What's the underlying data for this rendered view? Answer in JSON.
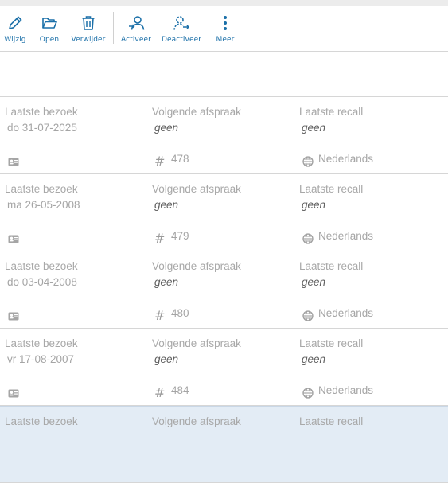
{
  "toolbar": {
    "buttons": [
      {
        "label": "Wijzig",
        "icon": "pencil-icon"
      },
      {
        "label": "Open",
        "icon": "folder-open-icon"
      },
      {
        "label": "Verwijder",
        "icon": "trash-icon"
      },
      {
        "label": "Activeer",
        "icon": "person-activate-icon"
      },
      {
        "label": "Deactiveer",
        "icon": "person-deactivate-icon"
      },
      {
        "label": "Meer",
        "icon": "more-vertical-icon"
      }
    ],
    "accent_color": "#1a6fa8"
  },
  "labels": {
    "last_visit": "Laatste bezoek",
    "next_appointment": "Volgende afspraak",
    "last_recall": "Laatste recall"
  },
  "rows": [
    {
      "last_visit": "do 31-07-2025",
      "next_appointment": "geen",
      "last_recall": "geen",
      "number": "478",
      "language": "Nederlands"
    },
    {
      "last_visit": "ma 26-05-2008",
      "next_appointment": "geen",
      "last_recall": "geen",
      "number": "479",
      "language": "Nederlands"
    },
    {
      "last_visit": "do 03-04-2008",
      "next_appointment": "geen",
      "last_recall": "geen",
      "number": "480",
      "language": "Nederlands"
    },
    {
      "last_visit": "vr 17-08-2007",
      "next_appointment": "geen",
      "last_recall": "geen",
      "number": "484",
      "language": "Nederlands"
    }
  ],
  "selected_row_color": "#e3ecf5"
}
